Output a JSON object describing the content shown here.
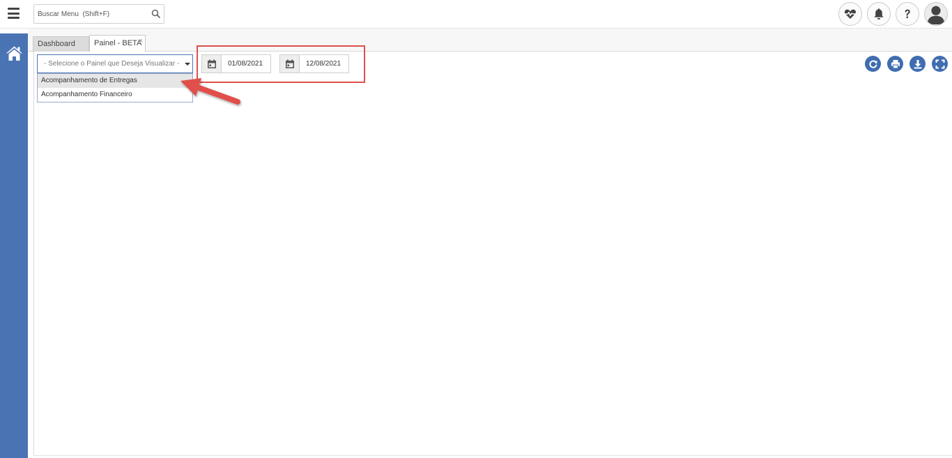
{
  "search": {
    "placeholder": "Buscar Menu  (Shift+F)"
  },
  "header": {
    "actions": [
      {
        "icon": "heart-pulse-icon"
      },
      {
        "icon": "bell-icon"
      },
      {
        "icon": "question-icon"
      },
      {
        "icon": "user-avatar-icon"
      }
    ]
  },
  "sidebar": {
    "items": [
      {
        "icon": "home-icon"
      }
    ]
  },
  "tabs": [
    {
      "label": "Dashboard",
      "active": false
    },
    {
      "label": "Painel - BETA",
      "active": true,
      "close_label": "×"
    }
  ],
  "panel_select": {
    "placeholder": "- Selecione o Painel que Deseja Visualizar -",
    "options": [
      {
        "label": "Acompanhamento de Entregas",
        "highlighted": true
      },
      {
        "label": "Acompanhamento Financeiro",
        "highlighted": false
      }
    ]
  },
  "date_range": {
    "start": "01/08/2021",
    "end": "12/08/2021"
  },
  "toolbar": {
    "icons": [
      "refresh-icon",
      "print-icon",
      "download-icon",
      "fullscreen-icon"
    ]
  },
  "colors": {
    "sidebar": "#4a73b3",
    "accent": "#3f6db0",
    "annotation": "#e0504c"
  }
}
